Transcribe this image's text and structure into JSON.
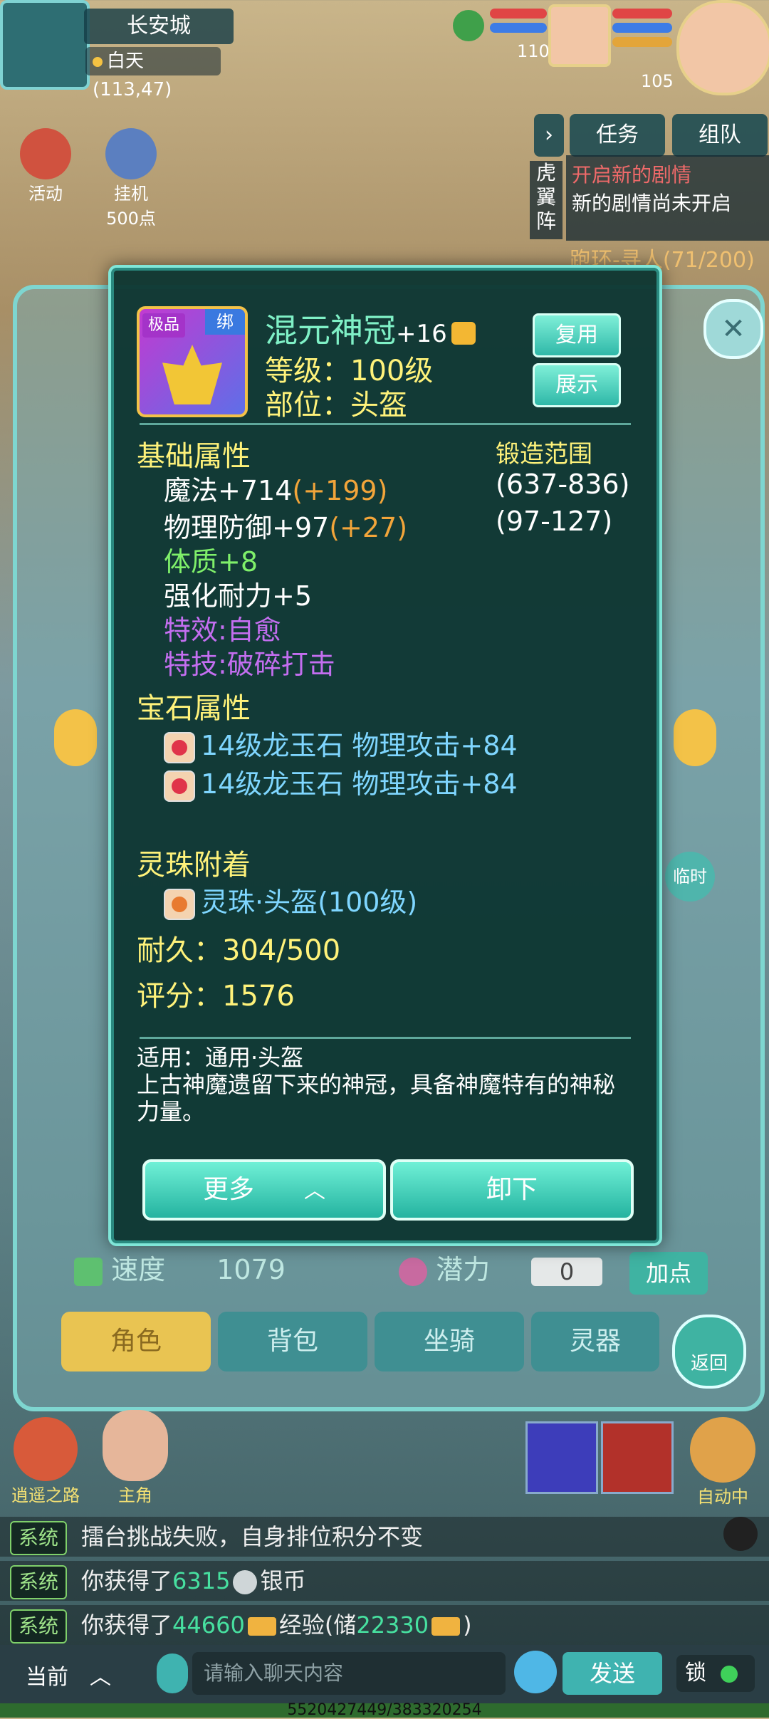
{
  "hud": {
    "city": "长安城",
    "time_coord": "白天(113,47)",
    "pet_level": "110",
    "player_level": "105",
    "activity_label": "活动",
    "afk_label": "挂机",
    "afk_points": "500点",
    "task_tab": "任务",
    "team_tab": "组队",
    "tiger_wing": "虎翼阵",
    "quest_line1": "开启新的剧情",
    "quest_line2": "新的剧情尚未开启",
    "quest_line3": "跑环-寻人(71/200)"
  },
  "background_panel": {
    "speed_label": "速度",
    "speed_value": "1079",
    "potential_label": "潜力",
    "potential_value": "0",
    "add_point_button": "加点",
    "temp_button": "临时",
    "tabs": [
      "角色",
      "背包",
      "坐骑",
      "灵器"
    ],
    "back_button": "返回"
  },
  "item": {
    "badge_rank": "极品",
    "badge_bound": "绑",
    "name": "混元神冠",
    "enhance": "+16",
    "level_line": "等级：100级",
    "slot_line": "部位：头盔",
    "reuse_button": "复用",
    "show_button": "展示",
    "base_title": "基础属性",
    "forge_title": "锻造范围",
    "magic": "魔法+714",
    "magic_bonus": "(+199)",
    "magic_range": "(637-836)",
    "pdef": "物理防御+97",
    "pdef_bonus": "(+27)",
    "pdef_range": "(97-127)",
    "constitution": "体质+8",
    "durability_bonus": "强化耐力+5",
    "effect": "特效:自愈",
    "skill": "特技:破碎打击",
    "gem_title": "宝石属性",
    "gem1": "14级龙玉石 物理攻击+84",
    "gem2": "14级龙玉石 物理攻击+84",
    "orb_title": "灵珠附着",
    "orb": "灵珠·头盔(100级)",
    "durability": "耐久：304/500",
    "score": "评分：1576",
    "applicable": "适用：通用·头盔",
    "description": "上古神魔遗留下来的神冠，具备神魔特有的神秘力量。",
    "more_button": "更多",
    "unequip_button": "卸下"
  },
  "bottom": {
    "xiaoyao_label": "逍遥之路",
    "hero_label": "主角",
    "auto_label": "自动中",
    "chat": [
      {
        "tag": "系统",
        "text": "擂台挑战失败，自身排位积分不变"
      },
      {
        "tag": "系统",
        "pre": "你获得了",
        "num": "6315",
        "post": "银币"
      },
      {
        "tag": "系统",
        "pre": "你获得了",
        "num": "44660",
        "post": "经验(储",
        "num2": "22330",
        "post2": ")"
      }
    ],
    "channel": "当前",
    "input_placeholder": "请输入聊天内容",
    "send_button": "发送",
    "lock_label": "锁",
    "footer_id": "5520427449/383320254"
  },
  "colors": {
    "modal_bg": "#0e3632",
    "modal_border": "#7fe6d8",
    "title_yellow": "#fff27a",
    "name_green": "#7ff0c6",
    "bonus_orange": "#f2a53a",
    "green_attr": "#7ff06a",
    "purple_attr": "#c46ef0",
    "gem_blue": "#7fd6ff"
  }
}
